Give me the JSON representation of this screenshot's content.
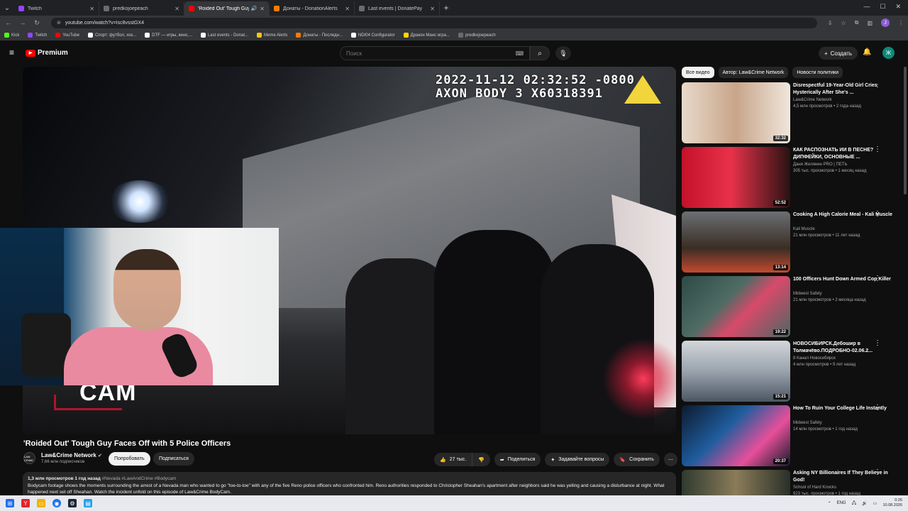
{
  "browser": {
    "tabs": [
      {
        "title": "Twitch",
        "color": "#9146ff"
      },
      {
        "title": "predkojoepeach",
        "color": "#6b6b6b"
      },
      {
        "title": "'Roided Out' Tough Guy Fa...",
        "color": "#ff0000",
        "active": true
      },
      {
        "title": "Донаты - DonationAlerts",
        "color": "#f57c00"
      },
      {
        "title": "Last events | DonatePay",
        "color": "#6b6b6b"
      }
    ],
    "url": "youtube.com/watch?v=Isc8vsstGX4",
    "bookmarks": [
      {
        "label": "Kick",
        "color": "#53fc18"
      },
      {
        "label": "Twitch",
        "color": "#9146ff"
      },
      {
        "label": "YouTube",
        "color": "#ff0000"
      },
      {
        "label": "Спорт: футбол, хок...",
        "color": "#ffffff"
      },
      {
        "label": "DTF — игры, кино,...",
        "color": "#ffffff"
      },
      {
        "label": "Last events - Donat...",
        "color": "#ffffff"
      },
      {
        "label": "Meme Alerts",
        "color": "#f5c518"
      },
      {
        "label": "Донаты - Последн...",
        "color": "#f57c00"
      },
      {
        "label": "NDI04 Configurator",
        "color": "#ffffff"
      },
      {
        "label": "Дракон Манс игра...",
        "color": "#ffd700"
      },
      {
        "label": "predkojoepeach",
        "color": "#6b6b6b"
      }
    ]
  },
  "youtube": {
    "logo": "Premium",
    "search_placeholder": "Поиск",
    "create_label": "Создать",
    "avatar_letter": "Ж"
  },
  "player": {
    "stamp_line1": "2022-11-12 02:32:52 -0800",
    "stamp_line2": "AXON BODY 3 X60318391",
    "cam_label": "CAM"
  },
  "video": {
    "title": "'Roided Out' Tough Guy Faces Off with 5 Police Officers",
    "channel": "Law&Crime Network",
    "channel_ava": "LAW CRIME",
    "subscribers": "7,66 млн подписчиков",
    "try_label": "Попробовать",
    "subscribe_label": "Подписаться",
    "likes": "27 тыс.",
    "share_label": "Поделиться",
    "ask_label": "Задавайте вопросы",
    "save_label": "Сохранить",
    "views_date": "1,3 млн просмотров  1 год назад",
    "hashtags": "#Nevada #LawAndCrime #Bodycam",
    "description": "Bodycam footage shows the moments surrounding the arrest of a Nevada man who wanted to go \"toe-to-toe\" with any of the five Reno police officers who confronted him. Reno authorities responded to Christopher Sheahan's apartment after neighbors said he was yelling and causing a disturbance at night. What happened next set off Sheahan. Watch the incident unfold on this episode of Law&Crime BodyCam."
  },
  "chips": [
    "Все видео",
    "Автор: Law&Crime Network",
    "Новости политики"
  ],
  "related": [
    {
      "title": "Disrespectful 19-Year-Old Girl Cries Hysterically After She's ...",
      "channel": "Law&Crime Network",
      "stats": "4,5 млн просмотров • 2 года назад",
      "duration": "32:32",
      "thumb": "linear-gradient(90deg,#e7d9c9 0%,#c8a58a 50%,#efe6dc 100%)"
    },
    {
      "title": "КАК РАСПОЗНАТЬ ИИ В ПЕСНЕ? ДИПФЕЙКИ, ОСНОВНЫЕ ...",
      "channel": "Даня Желянин PRO | ПЕТЬ",
      "stats": "305 тыс. просмотров • 1 месяц назад",
      "duration": "52:52",
      "thumb": "linear-gradient(90deg,#c2122a 0%,#e8324a 45%,#2a1212 100%)"
    },
    {
      "title": "Cooking A High Calorie Meal - Kali Muscle",
      "channel": "Kali Muscle",
      "stats": "21 млн просмотров • 11 лет назад",
      "duration": "13:14",
      "thumb": "linear-gradient(180deg,#6b6f74 0%,#3b2d24 60%,#c24a2f 100%)"
    },
    {
      "title": "100 Officers Hunt Down Armed Cop Killer",
      "channel": "Midwest Safety",
      "stats": "21 млн просмотров • 2 месяца назад",
      "duration": "19:22",
      "thumb": "linear-gradient(135deg,#2f4a45 0%,#4e6b64 40%,#d84a6a 60%,#4b6863 100%)"
    },
    {
      "title": "НОВОСИБИРСК.Дебошир в Толмачёво.ПОДРОБНО-02.06.2...",
      "channel": "8 Канал Новосибирск",
      "stats": "4 млн просмотров • 9 лет назад",
      "duration": "15:21",
      "thumb": "linear-gradient(180deg,#d3d6da 0%,#9aa3ad 50%,#4c5663 100%)"
    },
    {
      "title": "How To Ruin Your College Life Instantly",
      "channel": "Midwest Safety",
      "stats": "14 млн просмотров • 1 год назад",
      "duration": "20:37",
      "thumb": "linear-gradient(135deg,#0d1a2e 0%,#1f5d9e 40%,#e74f9a 70%,#141a2a 100%)"
    },
    {
      "title": "Asking NY Billionaires If They Believe in God!",
      "channel": "School of Hard Knocks",
      "stats": "923 тыс. просмотров • 1 год назад",
      "duration": "",
      "thumb": "linear-gradient(90deg,#2f3a2f 0%,#8a7c5a 50%,#2a2f28 100%)"
    }
  ],
  "taskbar": {
    "lang": "ENG",
    "time": "0:26",
    "date": "10.08.2026"
  }
}
